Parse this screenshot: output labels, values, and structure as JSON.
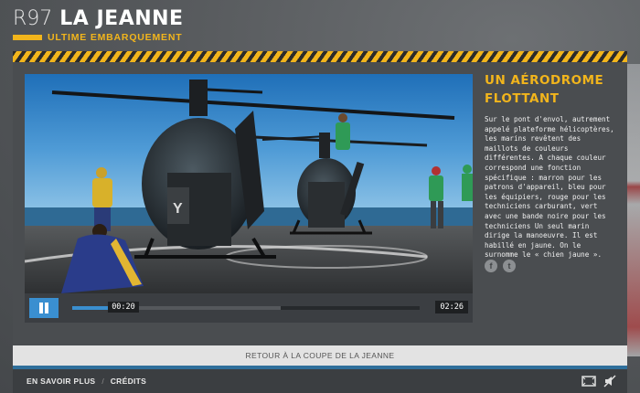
{
  "header": {
    "code": "R97",
    "title": "LA JEANNE",
    "subtitle": "ULTIME EMBARQUEMENT"
  },
  "video": {
    "current_time": "00:20",
    "total_time": "02:26",
    "progress": 0.14,
    "buffered": 0.6,
    "play_state_icon": "pause-icon",
    "marking": "Y"
  },
  "side": {
    "title_line1": "UN AÉRODROME",
    "title_line2": "FLOTTANT",
    "body": "Sur le pont d'envol, autrement appelé plateforme hélicoptères, les marins revêtent des maillots de couleurs différentes. A chaque couleur correspond une fonction spécifique : marron pour les patrons d'appareil, bleu pour les équipiers, rouge pour les techniciens carburant, vert avec une bande noire pour les techniciens Un seul marin dirige la manoeuvre. Il est habillé en jaune. On le surnomme le « chien jaune ».",
    "social": [
      {
        "label": "f",
        "icon": "facebook-icon"
      },
      {
        "label": "t",
        "icon": "twitter-icon"
      }
    ]
  },
  "return_bar": {
    "label": "RETOUR À LA COUPE DE LA JEANNE"
  },
  "footer": {
    "links": [
      "EN SAVOIR PLUS",
      "CRÉDITS"
    ],
    "separator": "/"
  },
  "colors": {
    "accent": "#f2b51c",
    "player_blue": "#3a8fd0",
    "background": "#55585b"
  }
}
